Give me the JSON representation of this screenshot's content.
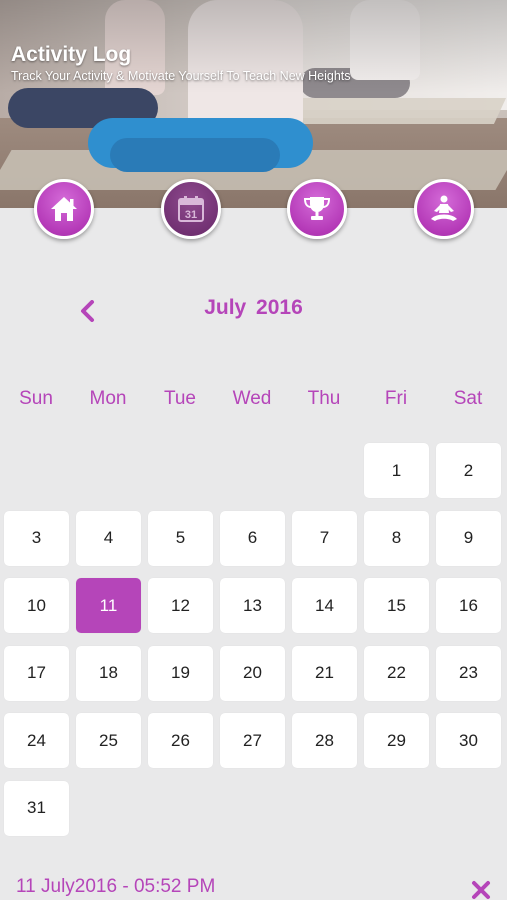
{
  "header": {
    "title": "Activity Log",
    "subtitle": "Track Your Activity & Motivate Yourself To Teach New Heights"
  },
  "nav": [
    {
      "name": "home",
      "icon": "home-icon"
    },
    {
      "name": "calendar",
      "icon": "calendar-icon",
      "icon_text": "31",
      "active": true
    },
    {
      "name": "achievements",
      "icon": "trophy-icon"
    },
    {
      "name": "meditation",
      "icon": "meditation-icon"
    }
  ],
  "calendar": {
    "prev_icon": "chevron-left-icon",
    "month_title": "July  2016",
    "weekdays": [
      "Sun",
      "Mon",
      "Tue",
      "Wed",
      "Thu",
      "Fri",
      "Sat"
    ],
    "first_weekday_index": 5,
    "days_in_month": 31,
    "selected_day": 11,
    "days": [
      "1",
      "2",
      "3",
      "4",
      "5",
      "6",
      "7",
      "8",
      "9",
      "10",
      "11",
      "12",
      "13",
      "14",
      "15",
      "16",
      "17",
      "18",
      "19",
      "20",
      "21",
      "22",
      "23",
      "24",
      "25",
      "26",
      "27",
      "28",
      "29",
      "30",
      "31"
    ]
  },
  "footer": {
    "entry_label": "11 July2016 - 05:52 PM",
    "close_icon": "close-icon"
  },
  "colors": {
    "accent": "#b545b9",
    "background": "#e9e9ea",
    "cell": "#ffffff"
  }
}
